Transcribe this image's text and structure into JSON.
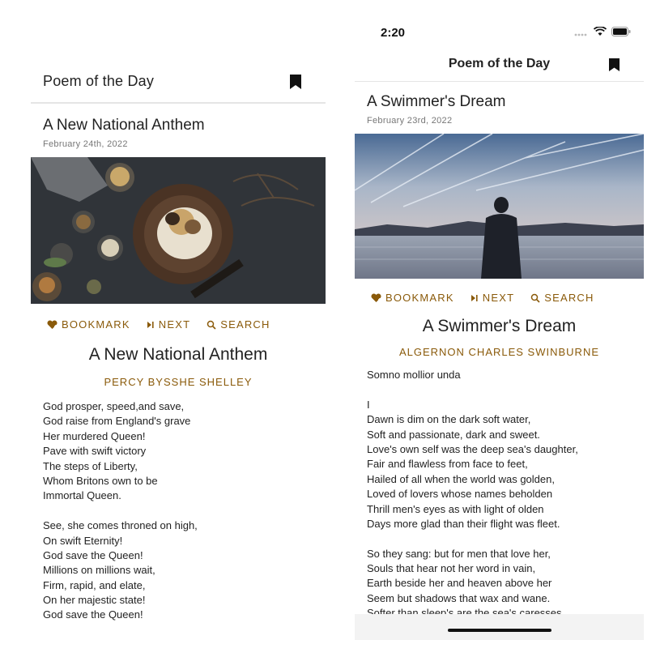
{
  "left": {
    "appbar": {
      "title": "Poem of the Day",
      "icon": "bookmark-icon"
    },
    "poem": {
      "heading": "A New National Anthem",
      "date": "February 24th, 2022",
      "title": "A New National Anthem",
      "author": "PERCY BYSSHE SHELLEY",
      "lines": [
        "God prosper, speed,and save,",
        "God raise from England's grave",
        "Her murdered Queen!",
        "Pave with swift victory",
        "The steps of Liberty,",
        "Whom Britons own to be",
        "Immortal Queen.",
        "",
        "See, she comes throned on high,",
        "On swift Eternity!",
        "God save the Queen!",
        "Millions on millions wait,",
        "Firm, rapid, and elate,",
        "On her majestic state!",
        "God save the Queen!"
      ]
    },
    "actions": {
      "bookmark": "BOOKMARK",
      "next": "NEXT",
      "search": "SEARCH"
    }
  },
  "right": {
    "statusbar": {
      "time": "2:20"
    },
    "appbar": {
      "title": "Poem of the Day",
      "icon": "bookmark-icon"
    },
    "poem": {
      "heading": "A Swimmer's Dream",
      "date": "February 23rd, 2022",
      "title": "A Swimmer's Dream",
      "author": "ALGERNON CHARLES SWINBURNE",
      "lines": [
        "Somno mollior unda",
        "",
        "I",
        "Dawn is dim on the dark soft water,",
        "Soft and passionate, dark and sweet.",
        "Love's own self was the deep sea's daughter,",
        "Fair and flawless from face to feet,",
        "Hailed of all when the world was golden,",
        "Loved of lovers whose names beholden",
        "Thrill men's eyes as with light of olden",
        "Days more glad than their flight was fleet.",
        "",
        "So they sang: but for men that love her,",
        "Souls that hear not her word in vain,",
        "Earth beside her and heaven above her",
        "Seem but shadows that wax and wane.",
        "Softer than sleep's are the sea's caresses"
      ]
    },
    "actions": {
      "bookmark": "BOOKMARK",
      "next": "NEXT",
      "search": "SEARCH"
    }
  },
  "colors": {
    "accent": "#8a5a0a",
    "text": "#222222",
    "divider": "#e5e5e5"
  }
}
